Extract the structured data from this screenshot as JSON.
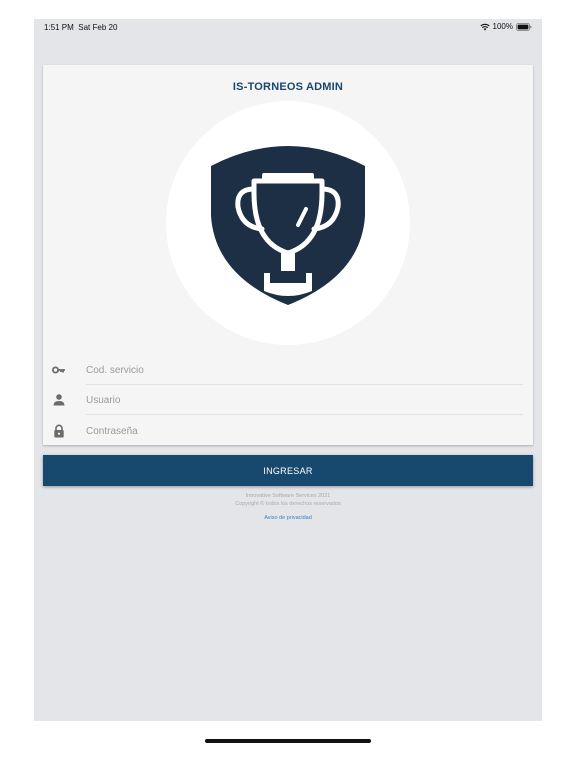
{
  "status_bar": {
    "time": "1:51 PM",
    "date": "Sat Feb 20",
    "battery_percent": "100%"
  },
  "app": {
    "title": "IS-TORNEOS ADMIN",
    "logo_icon": "trophy-shield-icon"
  },
  "form": {
    "service_code": {
      "placeholder": "Cod. servicio",
      "value": "",
      "icon": "key-icon"
    },
    "username": {
      "placeholder": "Usuario",
      "value": "",
      "icon": "person-icon"
    },
    "password": {
      "placeholder": "Contraseña",
      "value": "",
      "icon": "lock-icon"
    }
  },
  "login_button": {
    "label": "INGRESAR"
  },
  "footer": {
    "company": "Innovative Software Services 2021",
    "copyright": "Copyright © todos los derechos reservados",
    "privacy_link": "Aviso de privacidad"
  },
  "colors": {
    "primary": "#17496e",
    "logo": "#1c2f44",
    "link": "#3c7fc1",
    "background": "#e4e5e9"
  }
}
